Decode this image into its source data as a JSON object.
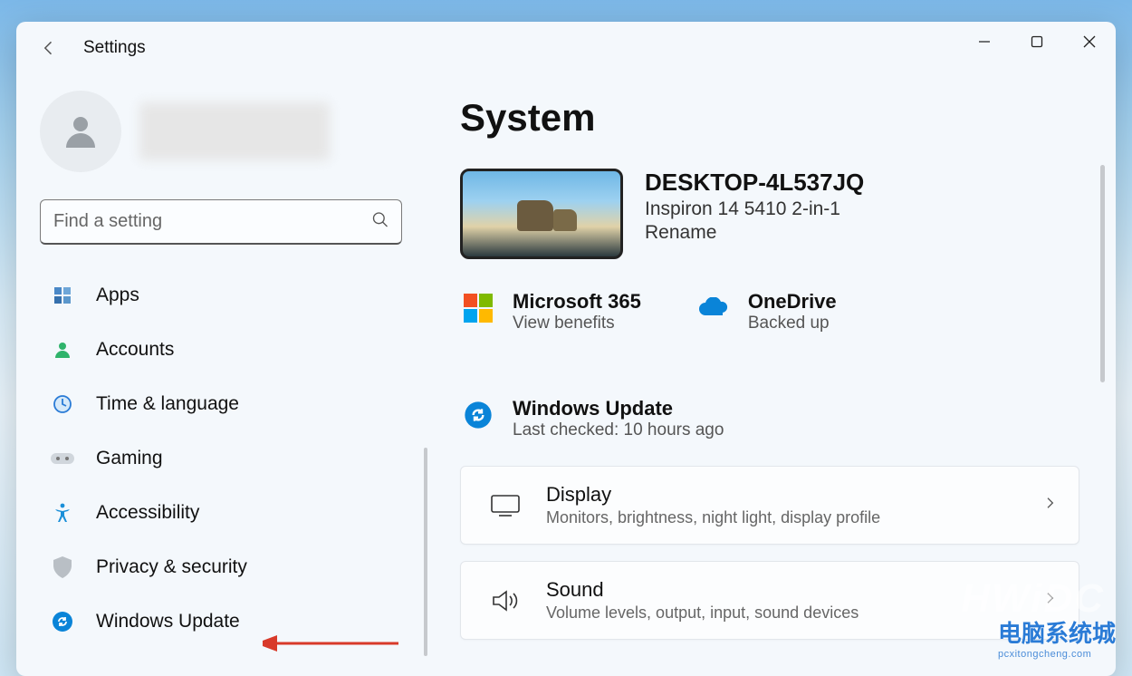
{
  "app": {
    "title": "Settings"
  },
  "search": {
    "placeholder": "Find a setting"
  },
  "page": {
    "title": "System"
  },
  "device": {
    "name": "DESKTOP-4L537JQ",
    "model": "Inspiron 14 5410 2-in-1",
    "rename_label": "Rename"
  },
  "tiles": {
    "ms365": {
      "title": "Microsoft 365",
      "sub": "View benefits"
    },
    "onedrive": {
      "title": "OneDrive",
      "sub": "Backed up"
    },
    "winupdate": {
      "title": "Windows Update",
      "sub": "Last checked: 10 hours ago"
    }
  },
  "cards": {
    "display": {
      "title": "Display",
      "sub": "Monitors, brightness, night light, display profile"
    },
    "sound": {
      "title": "Sound",
      "sub": "Volume levels, output, input, sound devices"
    }
  },
  "nav": {
    "apps": "Apps",
    "accounts": "Accounts",
    "time": "Time & language",
    "gaming": "Gaming",
    "accessibility": "Accessibility",
    "privacy": "Privacy & security",
    "winupdate": "Windows Update"
  },
  "watermark": {
    "big": "HWiDC",
    "brand": "电脑系统城",
    "url": "pcxitongcheng.com"
  }
}
